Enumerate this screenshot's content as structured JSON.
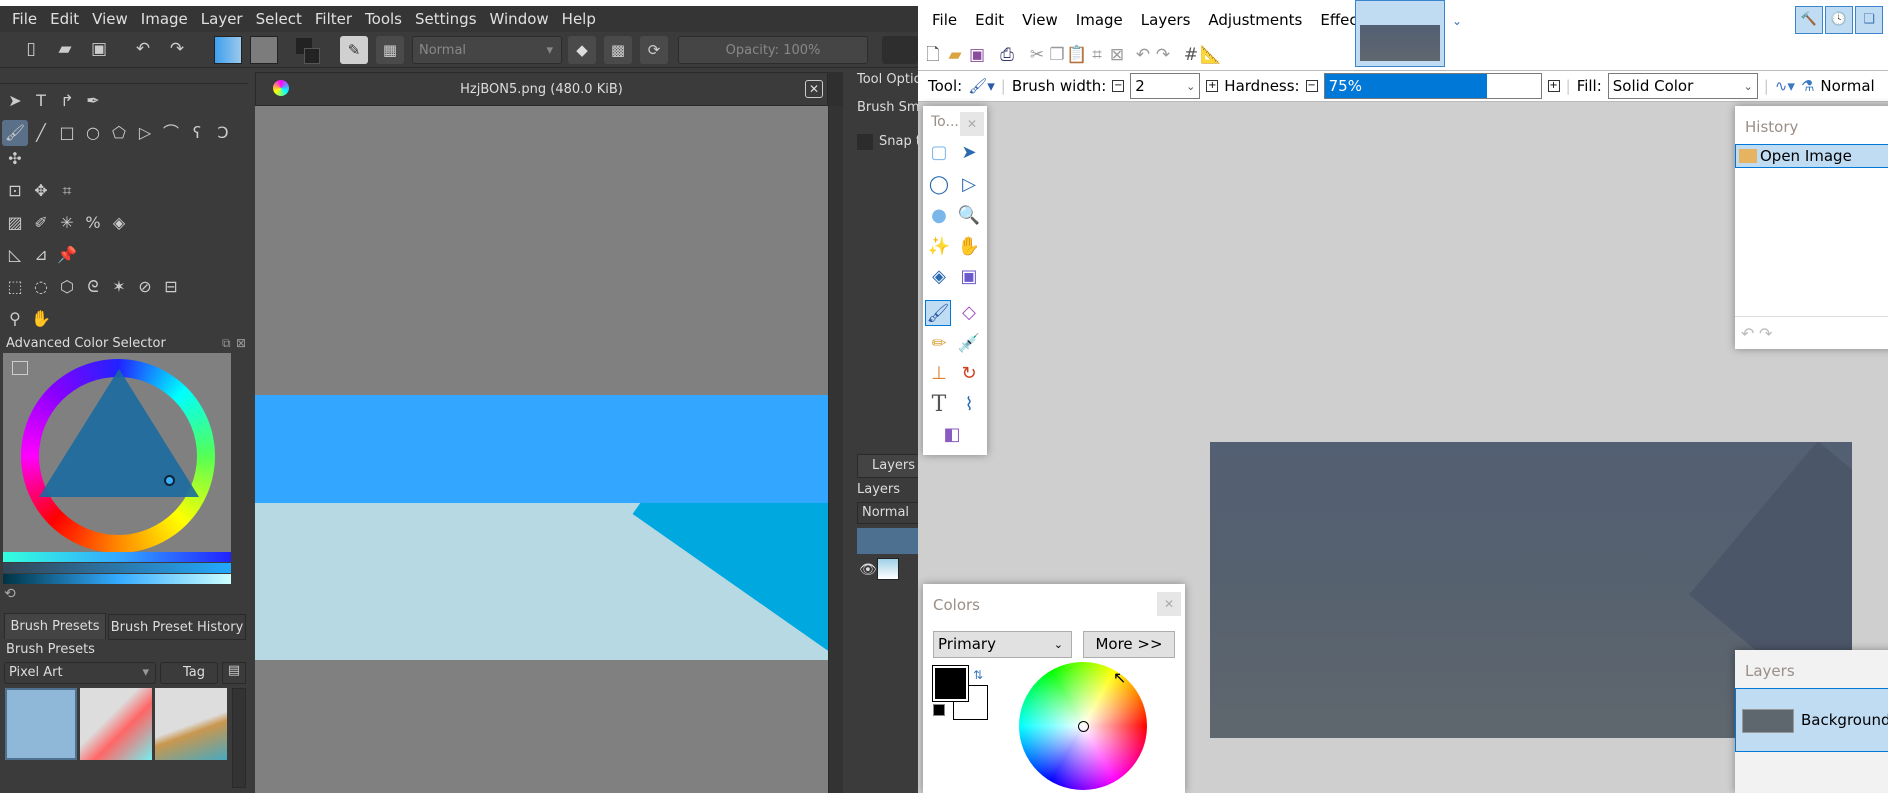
{
  "krita": {
    "menu": [
      "File",
      "Edit",
      "View",
      "Image",
      "Layer",
      "Select",
      "Filter",
      "Tools",
      "Settings",
      "Window",
      "Help"
    ],
    "toolbar": {
      "blend_mode": "Normal",
      "opacity": "Opacity: 100%"
    },
    "document_title": "HzjBON5.png (480.0 KiB)",
    "color_selector_title": "Advanced Color Selector",
    "brush_tabs": [
      "Brush Presets",
      "Brush Preset History"
    ],
    "brush_presets_title": "Brush Presets",
    "preset_filter": "Pixel Art",
    "tag_label": "Tag",
    "tool_options": {
      "title": "Tool Options",
      "brush_smoothing": "Brush Smoothing",
      "snap": "Snap to"
    },
    "layers": {
      "tab": "Layers",
      "title": "Layers",
      "blend": "Normal"
    }
  },
  "paintnet": {
    "menu": [
      "File",
      "Edit",
      "View",
      "Image",
      "Layers",
      "Adjustments",
      "Effects"
    ],
    "tool_options": {
      "tool_label": "Tool:",
      "brush_width_label": "Brush width:",
      "brush_width": "2",
      "hardness_label": "Hardness:",
      "hardness": "75%",
      "hardness_value": 75,
      "fill_label": "Fill:",
      "fill": "Solid Color",
      "blend": "Normal"
    },
    "tools_window_title": "To...",
    "history": {
      "title": "History",
      "items": [
        "Open Image"
      ]
    },
    "colors": {
      "title": "Colors",
      "mode": "Primary",
      "more": "More >>",
      "primary": "#000000",
      "secondary": "#ffffff"
    },
    "layers": {
      "title": "Layers",
      "items": [
        "Background"
      ]
    }
  }
}
